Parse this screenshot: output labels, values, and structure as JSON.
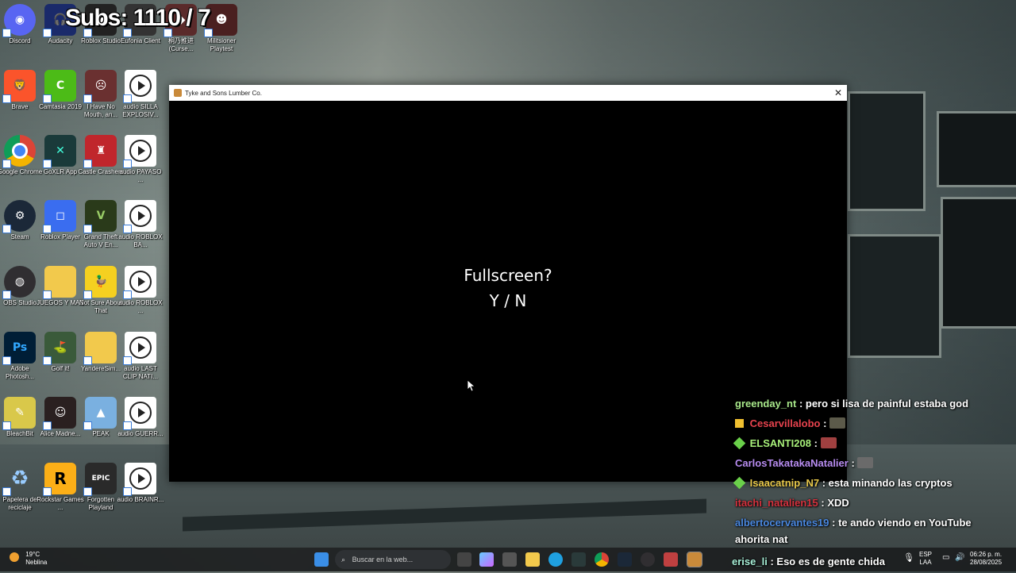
{
  "overlay": {
    "subs_text": "Subs: 1110 / 7"
  },
  "desktop": {
    "icons": [
      {
        "label": "Discord"
      },
      {
        "label": "Audacity"
      },
      {
        "label": "Roblox Studio"
      },
      {
        "label": "Eufonia Client"
      },
      {
        "label": "桐乃推进 (Curse..."
      },
      {
        "label": "Militsioner Playtest"
      },
      {
        "label": "Brave"
      },
      {
        "label": "Camtasia 2019"
      },
      {
        "label": "I Have No Mouth, an..."
      },
      {
        "label": "audio SILLA EXPLOSIV..."
      },
      {
        "label": "Google Chrome"
      },
      {
        "label": "GoXLR App"
      },
      {
        "label": "Castle Crashers"
      },
      {
        "label": "audio PAYASO ..."
      },
      {
        "label": "Steam"
      },
      {
        "label": "Roblox Player"
      },
      {
        "label": "Grand Theft Auto V En..."
      },
      {
        "label": "audio ROBLOX BA..."
      },
      {
        "label": "OBS Studio"
      },
      {
        "label": "JUEGOS Y MAS"
      },
      {
        "label": "Not Sure About That"
      },
      {
        "label": "audio ROBLOX ..."
      },
      {
        "label": "Adobe Photosh..."
      },
      {
        "label": "Golf it!"
      },
      {
        "label": "YandereSim..."
      },
      {
        "label": "audio LAST CLIP NATI..."
      },
      {
        "label": "BleachBit"
      },
      {
        "label": "Alice Madne..."
      },
      {
        "label": "PEAK"
      },
      {
        "label": "audio GUERR..."
      },
      {
        "label": "Papelera de reciclaje"
      },
      {
        "label": "Rockstar Games ..."
      },
      {
        "label": "Forgotten Playland"
      },
      {
        "label": "audio BRAINR..."
      }
    ]
  },
  "window": {
    "title": "Tyke and Sons Lumber Co.",
    "close_glyph": "✕",
    "prompt_line1": "Fullscreen?",
    "prompt_line2": "Y / N"
  },
  "chat": {
    "messages": [
      {
        "user": "greenday_nt",
        "text": ": pero si lisa de painful estaba god",
        "color": "#a8e88a"
      },
      {
        "user": "Cesarvillalobo",
        "text": ":",
        "color": "#e8434e",
        "badge": "crown-badge"
      },
      {
        "user": "ELSANTI208",
        "text": ":",
        "color": "#a8f07a",
        "badge": "plus-badge"
      },
      {
        "user": "CarlosTakatakaNatalier",
        "text": ":",
        "color": "#b78cf0"
      },
      {
        "user": "Isaacatnip_N7",
        "text": ": esta minando las cryptos",
        "color": "#e8c84a",
        "badge": "plus-badge"
      },
      {
        "user": "itachi_natalien15",
        "text": ": XDD",
        "color": "#d6323e"
      },
      {
        "user": "albertocervantes19",
        "text": ": te ando viendo en YouTube",
        "color": "#4a88e0"
      },
      {
        "user": "",
        "text": "ahorita nat",
        "color": "#ffffff"
      },
      {
        "user": "erise_li",
        "text": ": Eso es de gente chida",
        "color": "#a8f0d8"
      }
    ]
  },
  "taskbar": {
    "weather_temp": "19°C",
    "weather_desc": "Neblina",
    "search_placeholder": "Buscar en la web...",
    "lang_top": "ESP",
    "lang_bottom": "LAA",
    "time": "06:26 p. m.",
    "date": "28/08/2025"
  }
}
